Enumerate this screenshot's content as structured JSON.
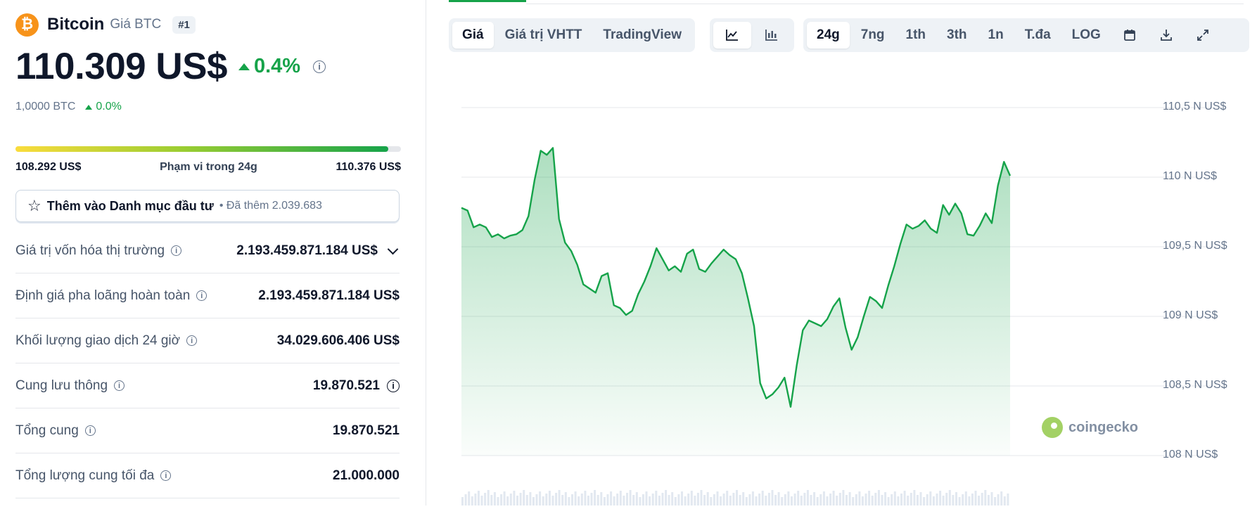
{
  "coin": {
    "logo_symbol": "₿",
    "name": "Bitcoin",
    "sub": "Giá BTC",
    "rank": "#1",
    "price": "110.309 US$",
    "change": "0.4%",
    "btc_amount": "1,0000 BTC",
    "btc_change": "0.0%"
  },
  "range": {
    "low": "108.292 US$",
    "label": "Phạm vi trong 24g",
    "high": "110.376 US$",
    "fill_percent": 96.8
  },
  "watchlist": {
    "label": "Thêm vào Danh mục đầu tư",
    "added": "• Đã thêm 2.039.683"
  },
  "stats": [
    {
      "label": "Giá trị vốn hóa thị trường",
      "value": "2.193.459.871.184 US$"
    },
    {
      "label": "Định giá pha loãng hoàn toàn",
      "value": "2.193.459.871.184 US$"
    },
    {
      "label": "Khối lượng giao dịch 24 giờ",
      "value": "34.029.606.406 US$"
    },
    {
      "label": "Cung lưu thông",
      "value": "19.870.521"
    },
    {
      "label": "Tổng cung",
      "value": "19.870.521"
    },
    {
      "label": "Tổng lượng cung tối đa",
      "value": "21.000.000"
    }
  ],
  "chart_tabs": [
    "Giá",
    "Giá trị VHTT",
    "TradingView"
  ],
  "chart_types": [
    "line-chart-icon",
    "candlestick-icon"
  ],
  "ranges": [
    "24g",
    "7ng",
    "1th",
    "3th",
    "1n",
    "T.đa",
    "LOG"
  ],
  "tools": [
    "calendar-icon",
    "download-icon",
    "expand-icon"
  ],
  "watermark": "coingecko",
  "colors": {
    "up": "#16a34a",
    "btc": "#f7931a"
  },
  "chart_data": {
    "type": "area",
    "title": "",
    "xlabel": "",
    "ylabel": "",
    "y_ticks": [
      "110,5 N US$",
      "110 N US$",
      "109,5 N US$",
      "109 N US$",
      "108,5 N US$",
      "108 N US$"
    ],
    "y_tick_values": [
      110500,
      110000,
      109500,
      109000,
      108500,
      108000
    ],
    "ylim": [
      108000,
      110500
    ],
    "grid": true,
    "series": [
      {
        "values": [
          109780,
          109760,
          109640,
          109660,
          109640,
          109570,
          109590,
          109560,
          109580,
          109590,
          109620,
          109720,
          109980,
          110190,
          110160,
          110210,
          109700,
          109530,
          109470,
          109370,
          109230,
          109200,
          109170,
          109290,
          109310,
          109080,
          109060,
          109010,
          109040,
          109160,
          109250,
          109360,
          109490,
          109410,
          109330,
          109360,
          109320,
          109450,
          109480,
          109340,
          109320,
          109380,
          109430,
          109480,
          109440,
          109410,
          109310,
          109130,
          108930,
          108520,
          108410,
          108440,
          108490,
          108560,
          108350,
          108650,
          108900,
          108970,
          108950,
          108930,
          108980,
          109070,
          109130,
          108920,
          108760,
          108850,
          109000,
          109140,
          109110,
          109060,
          109220,
          109360,
          109520,
          109660,
          109630,
          109650,
          109690,
          109630,
          109600,
          109800,
          109730,
          109810,
          109740,
          109590,
          109580,
          109650,
          109740,
          109670,
          109940,
          110110,
          110010
        ]
      }
    ]
  }
}
